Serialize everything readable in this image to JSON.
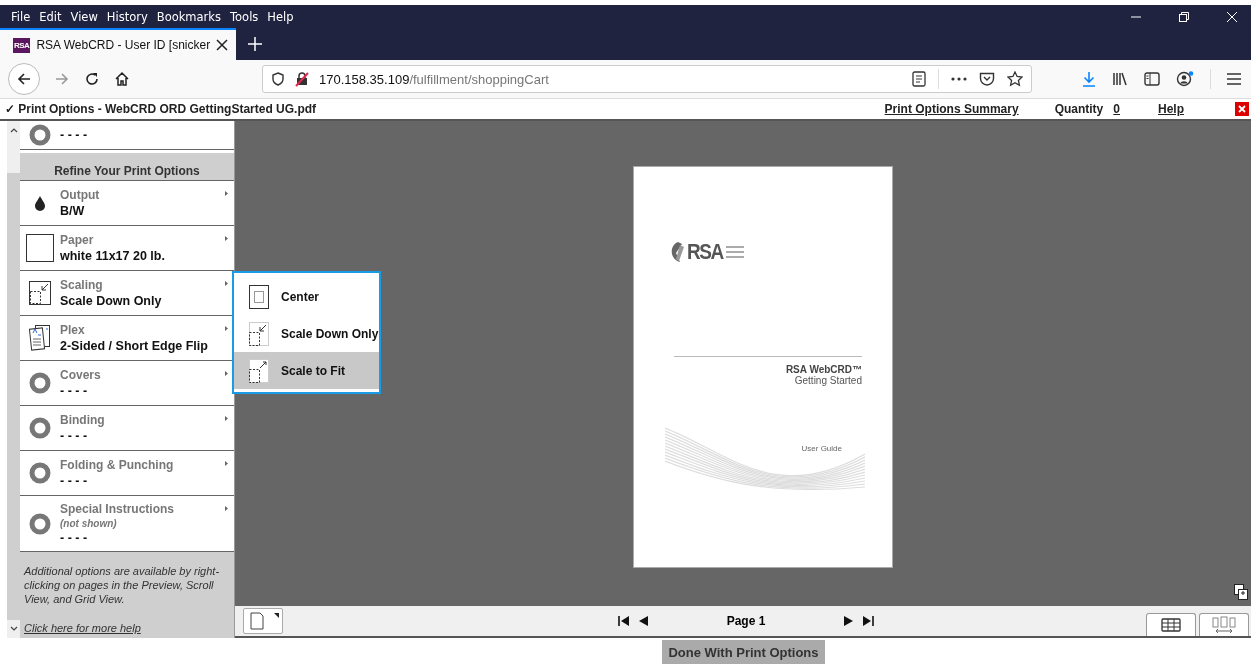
{
  "menu": [
    "File",
    "Edit",
    "View",
    "History",
    "Bookmarks",
    "Tools",
    "Help"
  ],
  "tab": {
    "badge": "RSA",
    "title": "RSA WebCRD - User ID [snicker"
  },
  "address": {
    "host": "170.158.35.109",
    "path": "/fulfillment/shoppingCart"
  },
  "header": {
    "title": "✓ Print Options - WebCRD ORD GettingStarted UG.pdf",
    "summary_link": "Print Options Summary",
    "quantity_label": "Quantity",
    "quantity": "0",
    "help_link": "Help"
  },
  "sidebar": {
    "partial_value": "- - - -",
    "section_title": "Refine Your Print Options",
    "items": [
      {
        "kind": "drop",
        "title": "Output",
        "value": "B/W"
      },
      {
        "kind": "paper",
        "title": "Paper",
        "value": "white 11x17 20 lb."
      },
      {
        "kind": "scale",
        "title": "Scaling",
        "value": "Scale Down Only"
      },
      {
        "kind": "plex",
        "title": "Plex",
        "value": "2-Sided / Short Edge Flip"
      },
      {
        "kind": "ring",
        "title": "Covers",
        "value": "- - - -"
      },
      {
        "kind": "ring",
        "title": "Binding",
        "value": "- - - -"
      },
      {
        "kind": "ring",
        "title": "Folding & Punching",
        "value": "- - - -"
      },
      {
        "kind": "ring",
        "title": "Special Instructions",
        "note": "(not shown)",
        "value": "- - - -"
      }
    ],
    "info": "Additional options are available by right-clicking on pages in the Preview, Scroll View, and Grid View.",
    "help_link": "Click here for more help"
  },
  "scaling_menu": [
    {
      "kind": "center",
      "label": "Center",
      "selected": false
    },
    {
      "kind": "down",
      "label": "Scale Down Only",
      "selected": false
    },
    {
      "kind": "fit",
      "label": "Scale to Fit",
      "selected": true
    }
  ],
  "document": {
    "logo": "RSA",
    "title": "RSA WebCRD™",
    "subtitle": "Getting Started",
    "note": "User Guide"
  },
  "pager": {
    "label": "Page 1"
  },
  "done_button": "Done With Print Options"
}
